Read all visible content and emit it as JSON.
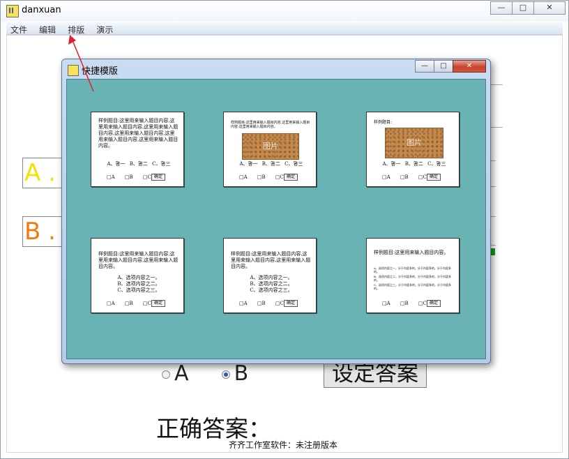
{
  "main_window": {
    "title": "danxuan",
    "controls": {
      "minimize": "—",
      "maximize": "□",
      "close": "✕"
    }
  },
  "menu": [
    "文件",
    "编辑",
    "排版",
    "演示"
  ],
  "options": {
    "a_label": "A .",
    "b_label": "B .",
    "a_color": "#f7e000",
    "b_color": "#f27a10"
  },
  "answer": {
    "radio_a": "A",
    "radio_b": "B",
    "selected": "B",
    "set_button": "设定答案",
    "correct_label": "正确答案："
  },
  "footer": "齐齐工作室软件：未注册版本",
  "dialog": {
    "title": "快捷模版",
    "background": "#6ab3b5",
    "templates": [
      {
        "question": "样例题目:这里用来输入题目内容,这里用来输入题目内容,这里用来输入题目内容,这里用来输入题目内容,这里用来输入题目内容,这里用来输入题目内容。",
        "options_row": [
          "A、答一",
          "B、答二",
          "C、答三"
        ],
        "foot": [
          "□A",
          "□B",
          "□C"
        ],
        "ok": "确定"
      },
      {
        "question": "样例题目:这里用来输入题目内容,这里用来输入题目内容,这里用来输入题目内容。",
        "image_label": "图片",
        "options_row": [
          "A、答一",
          "B、答二",
          "C、答三"
        ],
        "foot": [
          "□A",
          "□B",
          "□C"
        ],
        "ok": "确定"
      },
      {
        "question": "样例题目:",
        "image_label": "图片",
        "options_row": [
          "A、答一",
          "B、答二",
          "C、答三"
        ],
        "foot": [
          "□A",
          "□B",
          "□C"
        ],
        "ok": "确定"
      },
      {
        "question": "样例题目:这里用来输入题目内容,这里用来输入题目内容,这里用来输入题目内容。",
        "options_col": [
          "A、选项内容之一。",
          "B、选项内容之二。",
          "C、选项内容之三。"
        ],
        "foot": [
          "□A",
          "□B",
          "□C"
        ],
        "ok": "确定"
      },
      {
        "question": "样例题目:这里用来输入题目内容,这里用来输入题目内容,这里用来输入题目内容。",
        "options_col": [
          "A、选项内容之一。",
          "B、选项内容之二。",
          "C、选项内容之三。"
        ],
        "foot": [
          "□A",
          "□B",
          "□C"
        ],
        "ok": "确定"
      },
      {
        "question": "样例题目:这里用来输入题目内容。",
        "options_col": [
          "A、选项内容之一，分于内容多的，分于内容多的，分于内容多的。",
          "B、选项内容之二，分于内容多的，分于内容多的，分于内容多的。",
          "C、选项内容之三，分于内容多的，分于内容多的，分于内容多的。"
        ],
        "foot": [
          "□A",
          "□B",
          "□C"
        ],
        "ok": "确定"
      }
    ]
  }
}
